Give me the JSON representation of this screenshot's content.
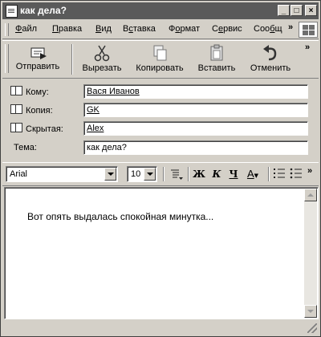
{
  "window": {
    "title": "как дела?",
    "controls": {
      "minimize": "_",
      "maximize": "□",
      "close": "×"
    }
  },
  "menu": {
    "items": [
      {
        "label": "Файл",
        "accel": "Ф",
        "rest": "айл"
      },
      {
        "label": "Правка",
        "accel": "П",
        "rest": "равка"
      },
      {
        "label": "Вид",
        "accel": "В",
        "rest": "ид"
      },
      {
        "label": "Вставка",
        "accel": "с",
        "pre": "В",
        "rest": "тавка"
      },
      {
        "label": "Формат",
        "accel": "о",
        "pre": "Ф",
        "rest": "рмат"
      },
      {
        "label": "Сервис",
        "accel": "е",
        "pre": "С",
        "rest": "рвис"
      },
      {
        "label": "Сообщ",
        "accel": "б",
        "pre": "Соо",
        "rest": "щ"
      }
    ],
    "overflow": "»"
  },
  "toolbar": {
    "buttons": [
      {
        "label": "Отправить",
        "icon": "send-icon"
      },
      {
        "label": "Вырезать",
        "icon": "scissors-icon"
      },
      {
        "label": "Копировать",
        "icon": "copy-icon"
      },
      {
        "label": "Вставить",
        "icon": "paste-icon"
      },
      {
        "label": "Отменить",
        "icon": "undo-icon"
      }
    ],
    "overflow": "»"
  },
  "header": {
    "to_label": "Кому:",
    "to_value": "Вася Иванов",
    "cc_label": "Копия:",
    "cc_value": "GK",
    "bcc_label": "Скрытая:",
    "bcc_value": "Alex",
    "subject_label": "Тема:",
    "subject_value": "как дела?"
  },
  "format": {
    "font": "Arial",
    "size": "10",
    "bold": "Ж",
    "italic": "К",
    "underline": "Ч",
    "font_color": "A",
    "overflow": "»"
  },
  "message": {
    "body": "Вот опять выдалась спокойная минутка..."
  }
}
